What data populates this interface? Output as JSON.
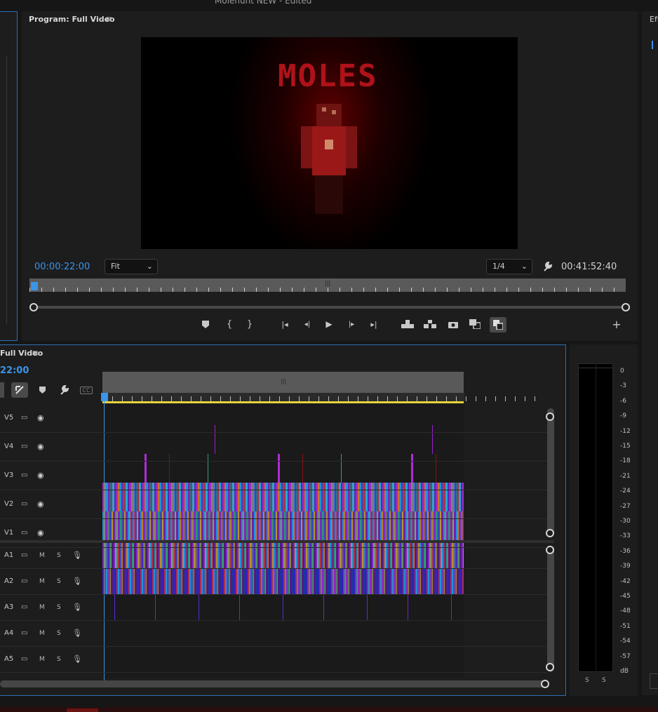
{
  "app_title": "Molehunt NEW - Edited",
  "program_monitor": {
    "title": "Program: Full Video",
    "current_timecode": "00:00:22:00",
    "zoom_select": "Fit",
    "resolution_select": "1/4",
    "duration_timecode": "00:41:52:40",
    "video_overlay_text": "MOLES"
  },
  "effects_panel": {
    "title_fragment": "Eff"
  },
  "timeline": {
    "title": "Full Video",
    "timecode_fragment": "22:00",
    "video_tracks": [
      "V5",
      "V4",
      "V3",
      "V2",
      "V1"
    ],
    "audio_tracks": [
      "A1",
      "A2",
      "A3",
      "A4",
      "A5"
    ],
    "mute_label": "M",
    "solo_label": "S",
    "captions_label": "CC"
  },
  "audio_meter": {
    "scale": [
      "0",
      "-3",
      "-6",
      "-9",
      "-12",
      "-15",
      "-18",
      "-21",
      "-24",
      "-27",
      "-30",
      "-33",
      "-36",
      "-39",
      "-42",
      "-45",
      "-48",
      "-51",
      "-54",
      "-57",
      "dB"
    ],
    "solo_labels": [
      "S",
      "S"
    ]
  },
  "colors": {
    "accent_blue": "#3a95ea",
    "panel_bg": "#1d1d1d",
    "work_area_yellow": "#e3d23a"
  }
}
